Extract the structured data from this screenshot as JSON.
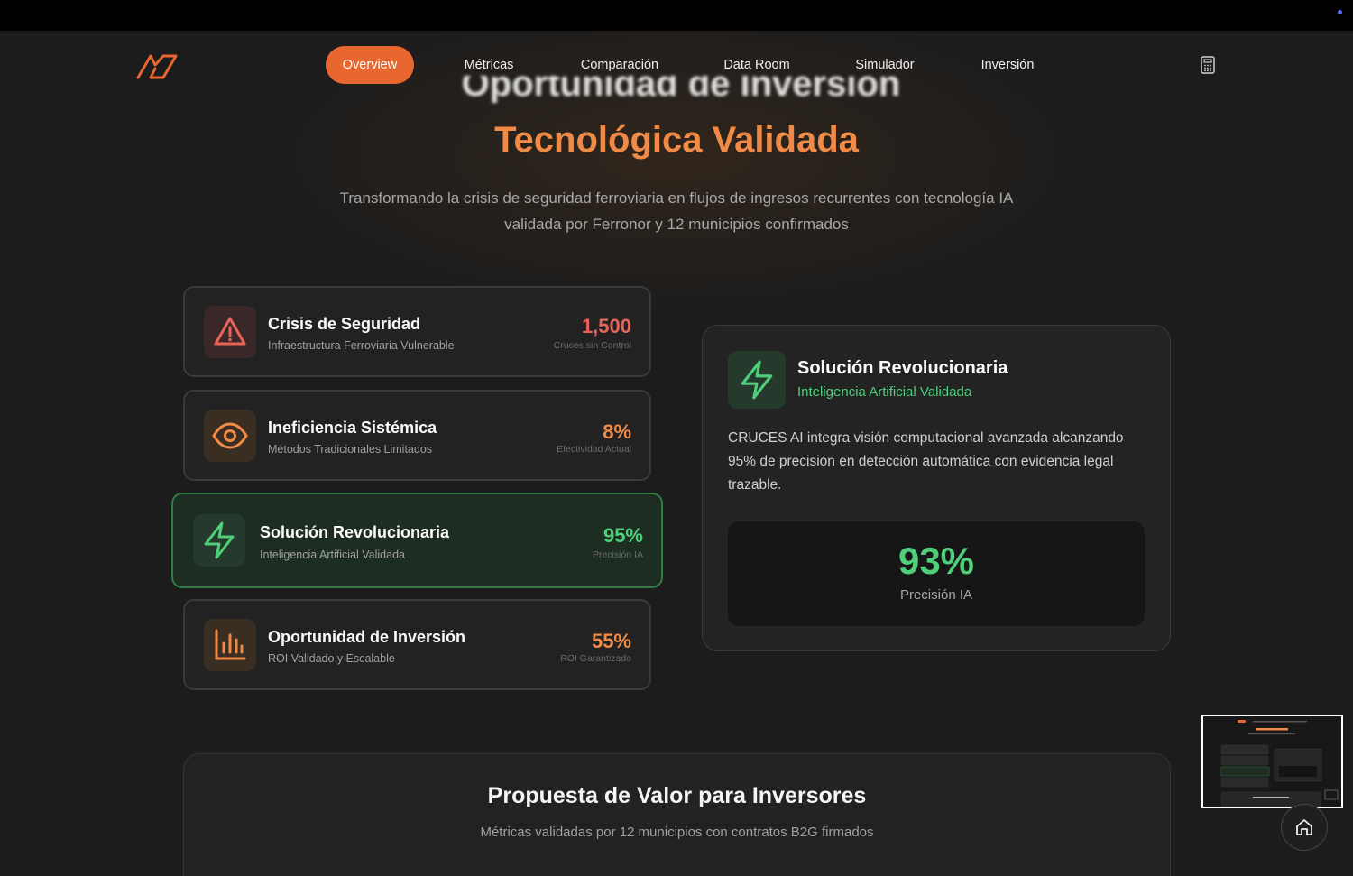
{
  "nav": {
    "items": [
      {
        "label": "Overview",
        "active": true
      },
      {
        "label": "Métricas",
        "active": false
      },
      {
        "label": "Comparación",
        "active": false
      },
      {
        "label": "Data Room",
        "active": false
      },
      {
        "label": "Simulador",
        "active": false
      },
      {
        "label": "Inversión",
        "active": false
      }
    ],
    "logo_icon": "brand-logo",
    "calculator_icon": "calculator-icon"
  },
  "hero": {
    "title_partial": "Oportunidad de Inversión",
    "title_highlight": "Tecnológica Validada",
    "subtitle_line1": "Transformando la crisis de seguridad ferroviaria en flujos de ingresos recurrentes con tecnología IA",
    "subtitle_line2": "validada por Ferronor y 12 municipios confirmados"
  },
  "cards": [
    {
      "title": "Crisis de Seguridad",
      "subtitle": "Infraestructura Ferroviaria Vulnerable",
      "value": "1,500",
      "value_label": "Cruces sin Control",
      "icon": "warning-icon",
      "color": "#e8645a"
    },
    {
      "title": "Ineficiencia Sistémica",
      "subtitle": "Métodos Tradicionales Limitados",
      "value": "8%",
      "value_label": "Efectividad Actual",
      "icon": "eye-icon",
      "color": "#f08a45"
    },
    {
      "title": "Solución Revolucionaria",
      "subtitle": "Inteligencia Artificial Validada",
      "value": "95%",
      "value_label": "Precisión IA",
      "icon": "lightning-icon",
      "color": "#4fcf7a"
    },
    {
      "title": "Oportunidad de Inversión",
      "subtitle": "ROI Validado y Escalable",
      "value": "55%",
      "value_label": "ROI Garantizado",
      "icon": "bar-chart-icon",
      "color": "#f08a45"
    }
  ],
  "detail": {
    "title": "Solución Revolucionaria",
    "subtitle": "Inteligencia Artificial Validada",
    "description": "CRUCES AI integra visión computacional avanzada alcanzando 95% de precisión en detección automática con evidencia legal trazable.",
    "stat_value": "93%",
    "stat_label": "Precisión IA",
    "icon": "lightning-icon"
  },
  "value_section": {
    "title": "Propuesta de Valor para Inversores",
    "subtitle": "Métricas validadas por 12 municipios con contratos B2G firmados"
  },
  "floating": {
    "home_icon": "home-icon"
  }
}
